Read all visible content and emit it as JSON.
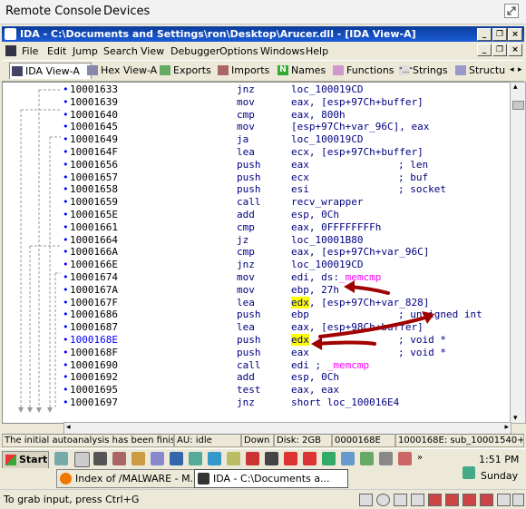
{
  "remote_console_menu": {
    "items": [
      "Remote Console",
      "Devices"
    ]
  },
  "ida": {
    "title": "IDA - C:\\Documents and Settings\\ron\\Desktop\\Arucer.dll - [IDA View-A]",
    "menu": [
      "File",
      "Edit",
      "Jump",
      "Search",
      "View",
      "Debugger",
      "Options",
      "Windows",
      "Help"
    ],
    "tabs": [
      "IDA View-A",
      "Hex View-A",
      "Exports",
      "Imports",
      "Names",
      "Functions",
      "Strings",
      "Structu"
    ],
    "disasm": [
      {
        "addr": "10001633",
        "mn": "jnz",
        "op": "loc_100019CD"
      },
      {
        "addr": "10001639",
        "mn": "mov",
        "op": "eax, [esp+97Ch+buffer]"
      },
      {
        "addr": "10001640",
        "mn": "cmp",
        "op": "eax, 800h"
      },
      {
        "addr": "10001645",
        "mn": "mov",
        "op": "[esp+97Ch+var_96C], eax"
      },
      {
        "addr": "10001649",
        "mn": "ja",
        "op": "loc_100019CD"
      },
      {
        "addr": "1000164F",
        "mn": "lea",
        "op": "ecx, [esp+97Ch+buffer]"
      },
      {
        "addr": "10001656",
        "mn": "push",
        "op": "eax",
        "cm": "; len"
      },
      {
        "addr": "10001657",
        "mn": "push",
        "op": "ecx",
        "cm": "; buf"
      },
      {
        "addr": "10001658",
        "mn": "push",
        "op": "esi",
        "cm": "; socket"
      },
      {
        "addr": "10001659",
        "mn": "call",
        "op": "recv_wrapper"
      },
      {
        "addr": "1000165E",
        "mn": "add",
        "op": "esp, 0Ch"
      },
      {
        "addr": "10001661",
        "mn": "cmp",
        "op": "eax, 0FFFFFFFFh"
      },
      {
        "addr": "10001664",
        "mn": "jz",
        "op": "loc_10001B80"
      },
      {
        "addr": "1000166A",
        "mn": "cmp",
        "op": "eax, [esp+97Ch+var_96C]"
      },
      {
        "addr": "1000166E",
        "mn": "jnz",
        "op": "loc_100019CD"
      },
      {
        "addr": "10001674",
        "mn": "mov",
        "op_pre": "edi, ds:",
        "op_pink": "_memcmp"
      },
      {
        "addr": "1000167A",
        "mn": "mov",
        "op": "ebp, 27h"
      },
      {
        "addr": "1000167F",
        "mn": "lea",
        "op_hl": "edx",
        "op_post": ", [esp+97Ch+var_828]"
      },
      {
        "addr": "10001686",
        "mn": "push",
        "op": "ebp",
        "cm": "; unsigned int"
      },
      {
        "addr": "10001687",
        "mn": "lea",
        "op": "eax, [esp+98Ch+buffer]"
      },
      {
        "addr": "1000168E",
        "mn": "push",
        "op_hl": "edx",
        "cm": "; void *",
        "addr_blue": true
      },
      {
        "addr": "1000168F",
        "mn": "push",
        "op": "eax",
        "cm": "; void *"
      },
      {
        "addr": "10001690",
        "mn": "call",
        "op_pre": "edi ; ",
        "op_pink": "_memcmp"
      },
      {
        "addr": "10001692",
        "mn": "add",
        "op": "esp, 0Ch"
      },
      {
        "addr": "10001695",
        "mn": "test",
        "op": "eax, eax"
      },
      {
        "addr": "10001697",
        "mn": "jnz",
        "op": "short loc_100016E4"
      }
    ],
    "status": {
      "message": "The initial autoanalysis has been finished.",
      "au": "AU:",
      "au_state": "idle",
      "direction": "Down",
      "disk": "Disk: 2GB",
      "offset": "0000168E",
      "location": "1000168E: sub_10001540+"
    }
  },
  "taskbar": {
    "start_label": "Start",
    "tasks": [
      "Index of /MALWARE - M...",
      "IDA - C:\\Documents a..."
    ],
    "clock_time": "1:51 PM",
    "clock_day": "Sunday"
  },
  "bottom_hint": "To grab input, press Ctrl+G"
}
